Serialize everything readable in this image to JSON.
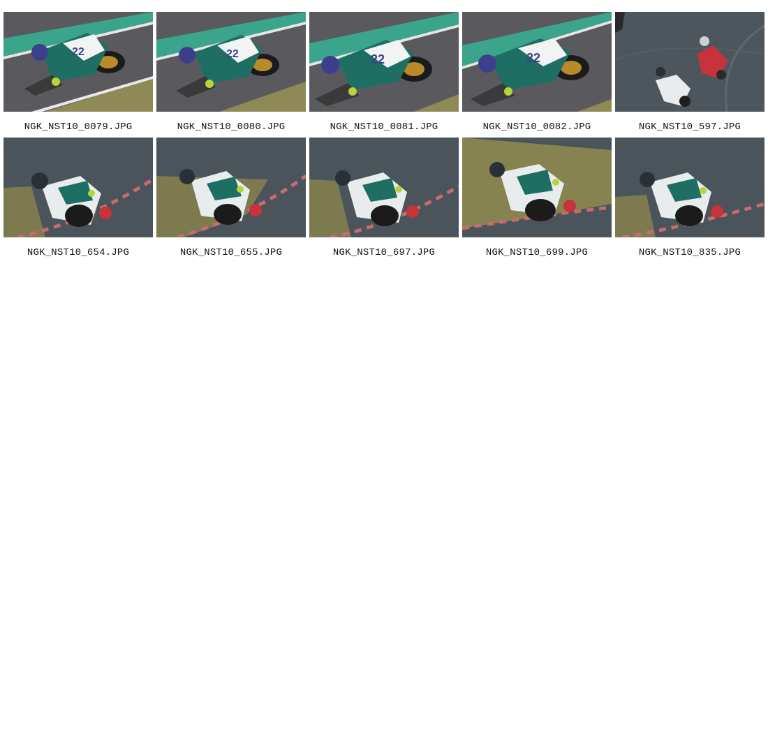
{
  "gallery": {
    "items": [
      {
        "filename": "NGK_NST10_0079.JPG",
        "scene": "dry"
      },
      {
        "filename": "NGK_NST10_0080.JPG",
        "scene": "dry"
      },
      {
        "filename": "NGK_NST10_0081.JPG",
        "scene": "dry"
      },
      {
        "filename": "NGK_NST10_0082.JPG",
        "scene": "dry"
      },
      {
        "filename": "NGK_NST10_597.JPG",
        "scene": "wet-two"
      },
      {
        "filename": "NGK_NST10_654.JPG",
        "scene": "wet"
      },
      {
        "filename": "NGK_NST10_655.JPG",
        "scene": "wet"
      },
      {
        "filename": "NGK_NST10_697.JPG",
        "scene": "wet"
      },
      {
        "filename": "NGK_NST10_699.JPG",
        "scene": "wet-grass"
      },
      {
        "filename": "NGK_NST10_835.JPG",
        "scene": "wet"
      }
    ]
  },
  "colors": {
    "track_dry": "#5a5a5e",
    "track_wet": "#4a545a",
    "teal_stripe": "#3aa58a",
    "grass": "#8f8a55",
    "fairing": "#f2f4f4",
    "livery_teal": "#1f6e64",
    "helmet_blue": "#3c3f8c",
    "rival_red": "#c8323a"
  }
}
